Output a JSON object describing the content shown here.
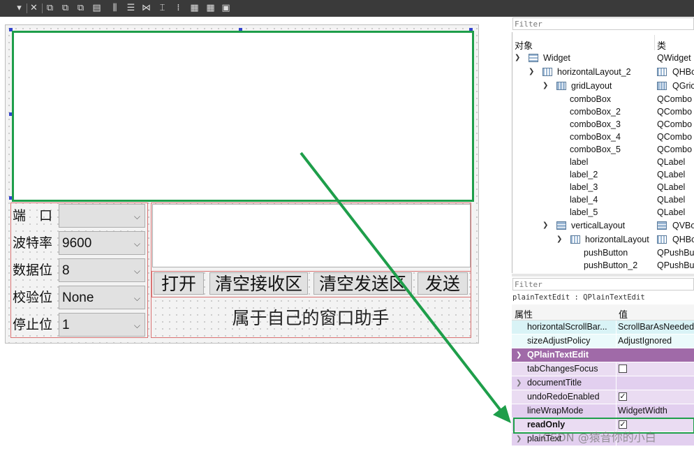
{
  "toolbar": {
    "menu_arrow": "▾",
    "close_glyph": "✕"
  },
  "form": {
    "rows": [
      {
        "label": "端　口",
        "value": ""
      },
      {
        "label": "波特率",
        "value": "9600"
      },
      {
        "label": "数据位",
        "value": "8"
      },
      {
        "label": "校验位",
        "value": "None"
      },
      {
        "label": "停止位",
        "value": "1"
      }
    ],
    "buttons": {
      "open": "打开",
      "clear_rx": "清空接收区",
      "clear_tx": "清空发送区",
      "send": "发送"
    },
    "title": "属于自己的窗口助手"
  },
  "object_inspector": {
    "filter_placeholder": "Filter",
    "col_object": "对象",
    "col_class": "类",
    "tree": [
      {
        "name": "Widget",
        "cls": "QWidget"
      },
      {
        "name": "horizontalLayout_2",
        "cls": "QHBo"
      },
      {
        "name": "gridLayout",
        "cls": "QGric"
      },
      {
        "name": "comboBox",
        "cls": "QCombo"
      },
      {
        "name": "comboBox_2",
        "cls": "QCombo"
      },
      {
        "name": "comboBox_3",
        "cls": "QCombo"
      },
      {
        "name": "comboBox_4",
        "cls": "QCombo"
      },
      {
        "name": "comboBox_5",
        "cls": "QCombo"
      },
      {
        "name": "label",
        "cls": "QLabel"
      },
      {
        "name": "label_2",
        "cls": "QLabel"
      },
      {
        "name": "label_3",
        "cls": "QLabel"
      },
      {
        "name": "label_4",
        "cls": "QLabel"
      },
      {
        "name": "label_5",
        "cls": "QLabel"
      },
      {
        "name": "verticalLayout",
        "cls": "QVBo"
      },
      {
        "name": "horizontalLayout",
        "cls": "QHBo"
      },
      {
        "name": "pushButton",
        "cls": "QPushBu"
      },
      {
        "name": "pushButton_2",
        "cls": "QPushBu"
      }
    ]
  },
  "property_editor": {
    "filter_placeholder": "Filter",
    "object_class": "plainTextEdit : QPlainTextEdit",
    "col_property": "属性",
    "col_value": "值",
    "section": "QPlainTextEdit",
    "rows": [
      {
        "name": "horizontalScrollBar...",
        "value": "ScrollBarAsNeeded"
      },
      {
        "name": "sizeAdjustPolicy",
        "value": "AdjustIgnored"
      },
      {
        "name": "tabChangesFocus",
        "checked": false
      },
      {
        "name": "documentTitle",
        "value": ""
      },
      {
        "name": "undoRedoEnabled",
        "checked": true
      },
      {
        "name": "lineWrapMode",
        "value": "WidgetWidth"
      },
      {
        "name": "readOnly",
        "checked": true
      },
      {
        "name": "plainText",
        "value": ""
      }
    ]
  },
  "watermark": "CSDN @猿音你的小白",
  "colors": {
    "highlight": "#1e9e4a",
    "section_bg": "#a06aa8",
    "prop_row_bg": "#eadcf2",
    "prop_row_bg_alt": "#f3ecf8"
  }
}
